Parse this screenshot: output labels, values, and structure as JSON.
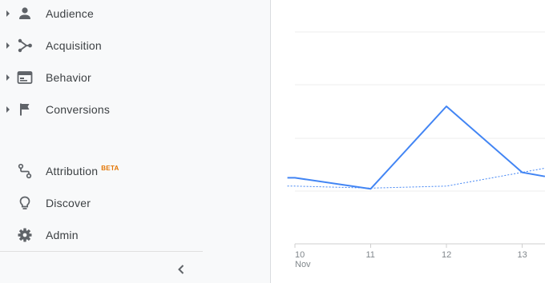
{
  "sidebar": {
    "items": [
      {
        "label": "Audience",
        "icon": "person-icon",
        "expandable": true
      },
      {
        "label": "Acquisition",
        "icon": "acquisition-icon",
        "expandable": true
      },
      {
        "label": "Behavior",
        "icon": "behavior-icon",
        "expandable": true
      },
      {
        "label": "Conversions",
        "icon": "flag-icon",
        "expandable": true
      },
      {
        "label": "Attribution",
        "icon": "attribution-icon",
        "badge": "BETA",
        "expandable": false
      },
      {
        "label": "Discover",
        "icon": "lightbulb-icon",
        "expandable": false
      },
      {
        "label": "Admin",
        "icon": "gear-icon",
        "expandable": false
      }
    ],
    "collapse_icon": "chevron-left-icon"
  },
  "colors": {
    "accent": "#4285f4",
    "sidebar_bg": "#f8f9fa",
    "icon": "#5f6368",
    "text": "#3c4043",
    "beta": "#e37400"
  },
  "chart_data": {
    "type": "line",
    "x_ticks": [
      "10",
      "11",
      "12",
      "13"
    ],
    "x_sublabel": "Nov",
    "grid": true,
    "series": [
      {
        "style": "solid",
        "x": [
          9.9,
          10,
          11,
          12,
          13,
          13.3
        ],
        "y": [
          0.48,
          0.48,
          0.4,
          1.0,
          0.52,
          0.49
        ]
      },
      {
        "style": "dashed",
        "x": [
          9.9,
          10,
          11,
          12,
          13,
          13.3
        ],
        "y": [
          0.42,
          0.42,
          0.405,
          0.42,
          0.52,
          0.55
        ]
      }
    ]
  }
}
